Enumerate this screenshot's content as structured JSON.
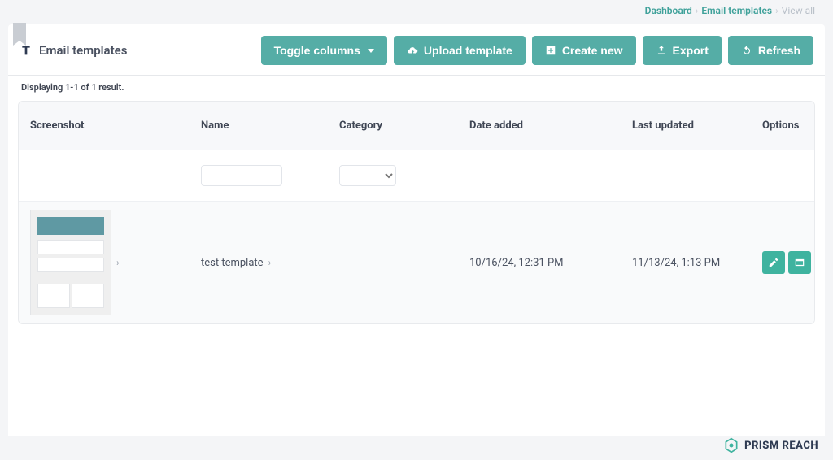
{
  "breadcrumb": {
    "dashboard": "Dashboard",
    "email_templates": "Email templates",
    "current": "View all"
  },
  "page_title": "Email templates",
  "toolbar": {
    "toggle_columns": "Toggle columns",
    "upload_template": "Upload template",
    "create_new": "Create new",
    "export": "Export",
    "refresh": "Refresh"
  },
  "result_count": "Displaying 1-1 of 1 result.",
  "columns": {
    "screenshot": "Screenshot",
    "name": "Name",
    "category": "Category",
    "date_added": "Date added",
    "last_updated": "Last updated",
    "options": "Options"
  },
  "filters": {
    "name_value": "",
    "category_value": ""
  },
  "rows": [
    {
      "name": "test template",
      "category": "",
      "date_added": "10/16/24, 12:31 PM",
      "last_updated": "11/13/24, 1:13 PM"
    }
  ],
  "brand": "PRISM REACH",
  "colors": {
    "accent": "#55ada6",
    "danger": "#e25e77",
    "dark": "#2e3a52"
  }
}
